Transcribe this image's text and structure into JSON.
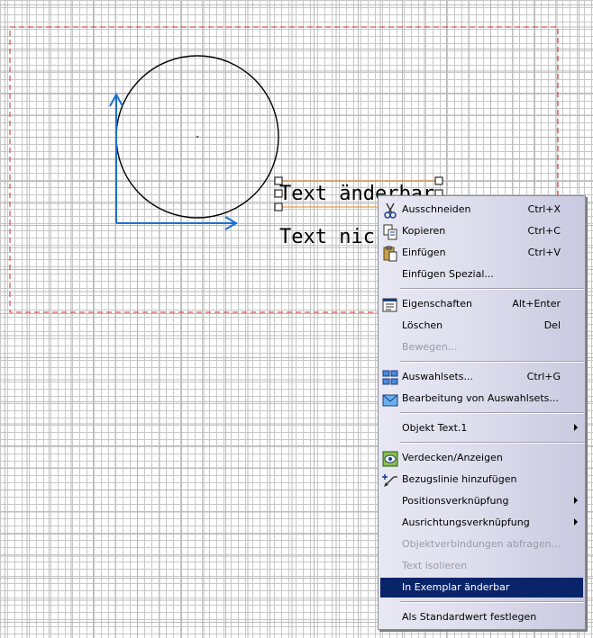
{
  "canvas": {
    "text_editable": "Text änderbar",
    "text_fixed": "Text nic"
  },
  "menu": {
    "items": [
      {
        "label": "Ausschneiden",
        "accel_key": "A",
        "shortcut": "Ctrl+X",
        "icon": "scissors-icon"
      },
      {
        "label": "Kopieren",
        "accel_key": "K",
        "shortcut": "Ctrl+C",
        "icon": "copy-icon"
      },
      {
        "label": "Einfügen",
        "accel_key": "E",
        "shortcut": "Ctrl+V",
        "icon": "paste-icon"
      },
      {
        "label": "Einfügen Spezial...",
        "shortcut": ""
      },
      {
        "label": "Eigenschaften",
        "accel_key": "E",
        "shortcut": "Alt+Enter",
        "icon": "properties-icon"
      },
      {
        "label": "Löschen",
        "accel_key": "L",
        "shortcut": "Del"
      },
      {
        "label": "Bewegen...",
        "shortcut": "",
        "disabled": true
      },
      {
        "label": "Auswahlsets...",
        "accel_key": "A",
        "shortcut": "Ctrl+G",
        "icon": "selection-sets-icon"
      },
      {
        "label": "Bearbeitung von Auswahlsets...",
        "shortcut": "",
        "icon": "edit-selection-sets-icon"
      },
      {
        "label": "Objekt Text.1",
        "shortcut": "",
        "submenu": true
      },
      {
        "label": "Verdecken/Anzeigen",
        "accel_key": "V",
        "shortcut": "",
        "icon": "hide-show-icon"
      },
      {
        "label": "Bezugslinie hinzufügen",
        "shortcut": "",
        "icon": "add-leader-icon"
      },
      {
        "label": "Positionsverknüpfung",
        "shortcut": "",
        "submenu": true
      },
      {
        "label": "Ausrichtungsverknüpfung",
        "shortcut": "",
        "submenu": true
      },
      {
        "label": "Objektverbindungen abfragen...",
        "shortcut": "",
        "disabled": true
      },
      {
        "label": "Text isolieren",
        "shortcut": "",
        "disabled": true
      },
      {
        "label": "In Exemplar änderbar",
        "shortcut": "",
        "highlighted": true
      },
      {
        "label": "Als Standardwert festlegen",
        "shortcut": ""
      }
    ]
  },
  "colors": {
    "frame_dashed": "#d42a2a",
    "axis": "#1a6fd6",
    "selection": "#e08a1e",
    "highlight": "#0a246a"
  }
}
